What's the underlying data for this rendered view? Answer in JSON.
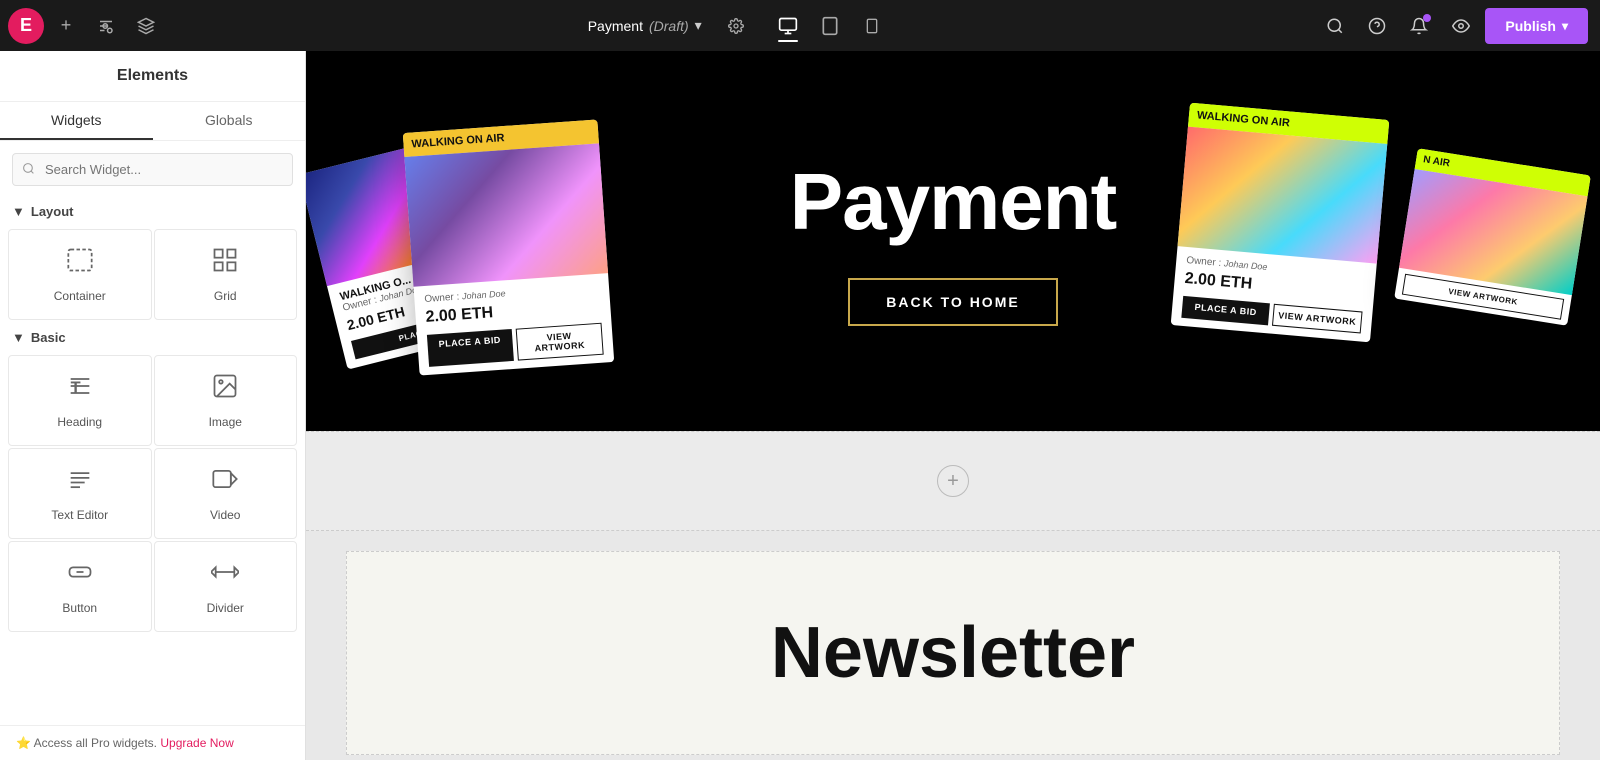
{
  "topbar": {
    "logo_label": "E",
    "add_icon": "+",
    "page_title": "Payment",
    "page_status": "(Draft)",
    "desktop_icon": "🖥",
    "tablet_icon": "⬜",
    "mobile_icon": "📱",
    "search_icon": "🔍",
    "help_icon": "?",
    "bell_icon": "🔔",
    "eye_icon": "👁",
    "publish_label": "Publish",
    "publish_chevron": "▾"
  },
  "sidebar": {
    "header": "Elements",
    "tab_widgets": "Widgets",
    "tab_globals": "Globals",
    "search_placeholder": "Search Widget...",
    "layout_section": "Layout",
    "basic_section": "Basic",
    "widgets": [
      {
        "id": "container",
        "label": "Container",
        "icon": "container"
      },
      {
        "id": "grid",
        "label": "Grid",
        "icon": "grid"
      },
      {
        "id": "heading",
        "label": "Heading",
        "icon": "heading"
      },
      {
        "id": "image",
        "label": "Image",
        "icon": "image"
      },
      {
        "id": "text-editor",
        "label": "Text Editor",
        "icon": "text"
      },
      {
        "id": "video",
        "label": "Video",
        "icon": "video"
      },
      {
        "id": "button",
        "label": "Button",
        "icon": "button"
      },
      {
        "id": "divider",
        "label": "Divider",
        "icon": "divider"
      }
    ],
    "footer_text": "Access all Pro widgets.",
    "upgrade_label": "Upgrade Now"
  },
  "canvas": {
    "hero_title": "Payment",
    "hero_btn_label": "BACK TO HOME",
    "nft_cards": [
      {
        "title": "WALKING ON AIR",
        "owner_label": "Owner :",
        "owner_name": "Johan Doe",
        "price": "2.00 ETH",
        "bid_label": "PLACE A BID",
        "view_label": "VIEW ARTWORK"
      },
      {
        "title": "WALKING ON AIR",
        "owner_label": "Owner :",
        "owner_name": "Johan Doe",
        "price": "2.00 ETH",
        "bid_label": "PLACE A BID",
        "view_label": "VIEW ARTWORK"
      }
    ],
    "newsletter_title": "Newsletter",
    "add_section_hint": "+"
  }
}
